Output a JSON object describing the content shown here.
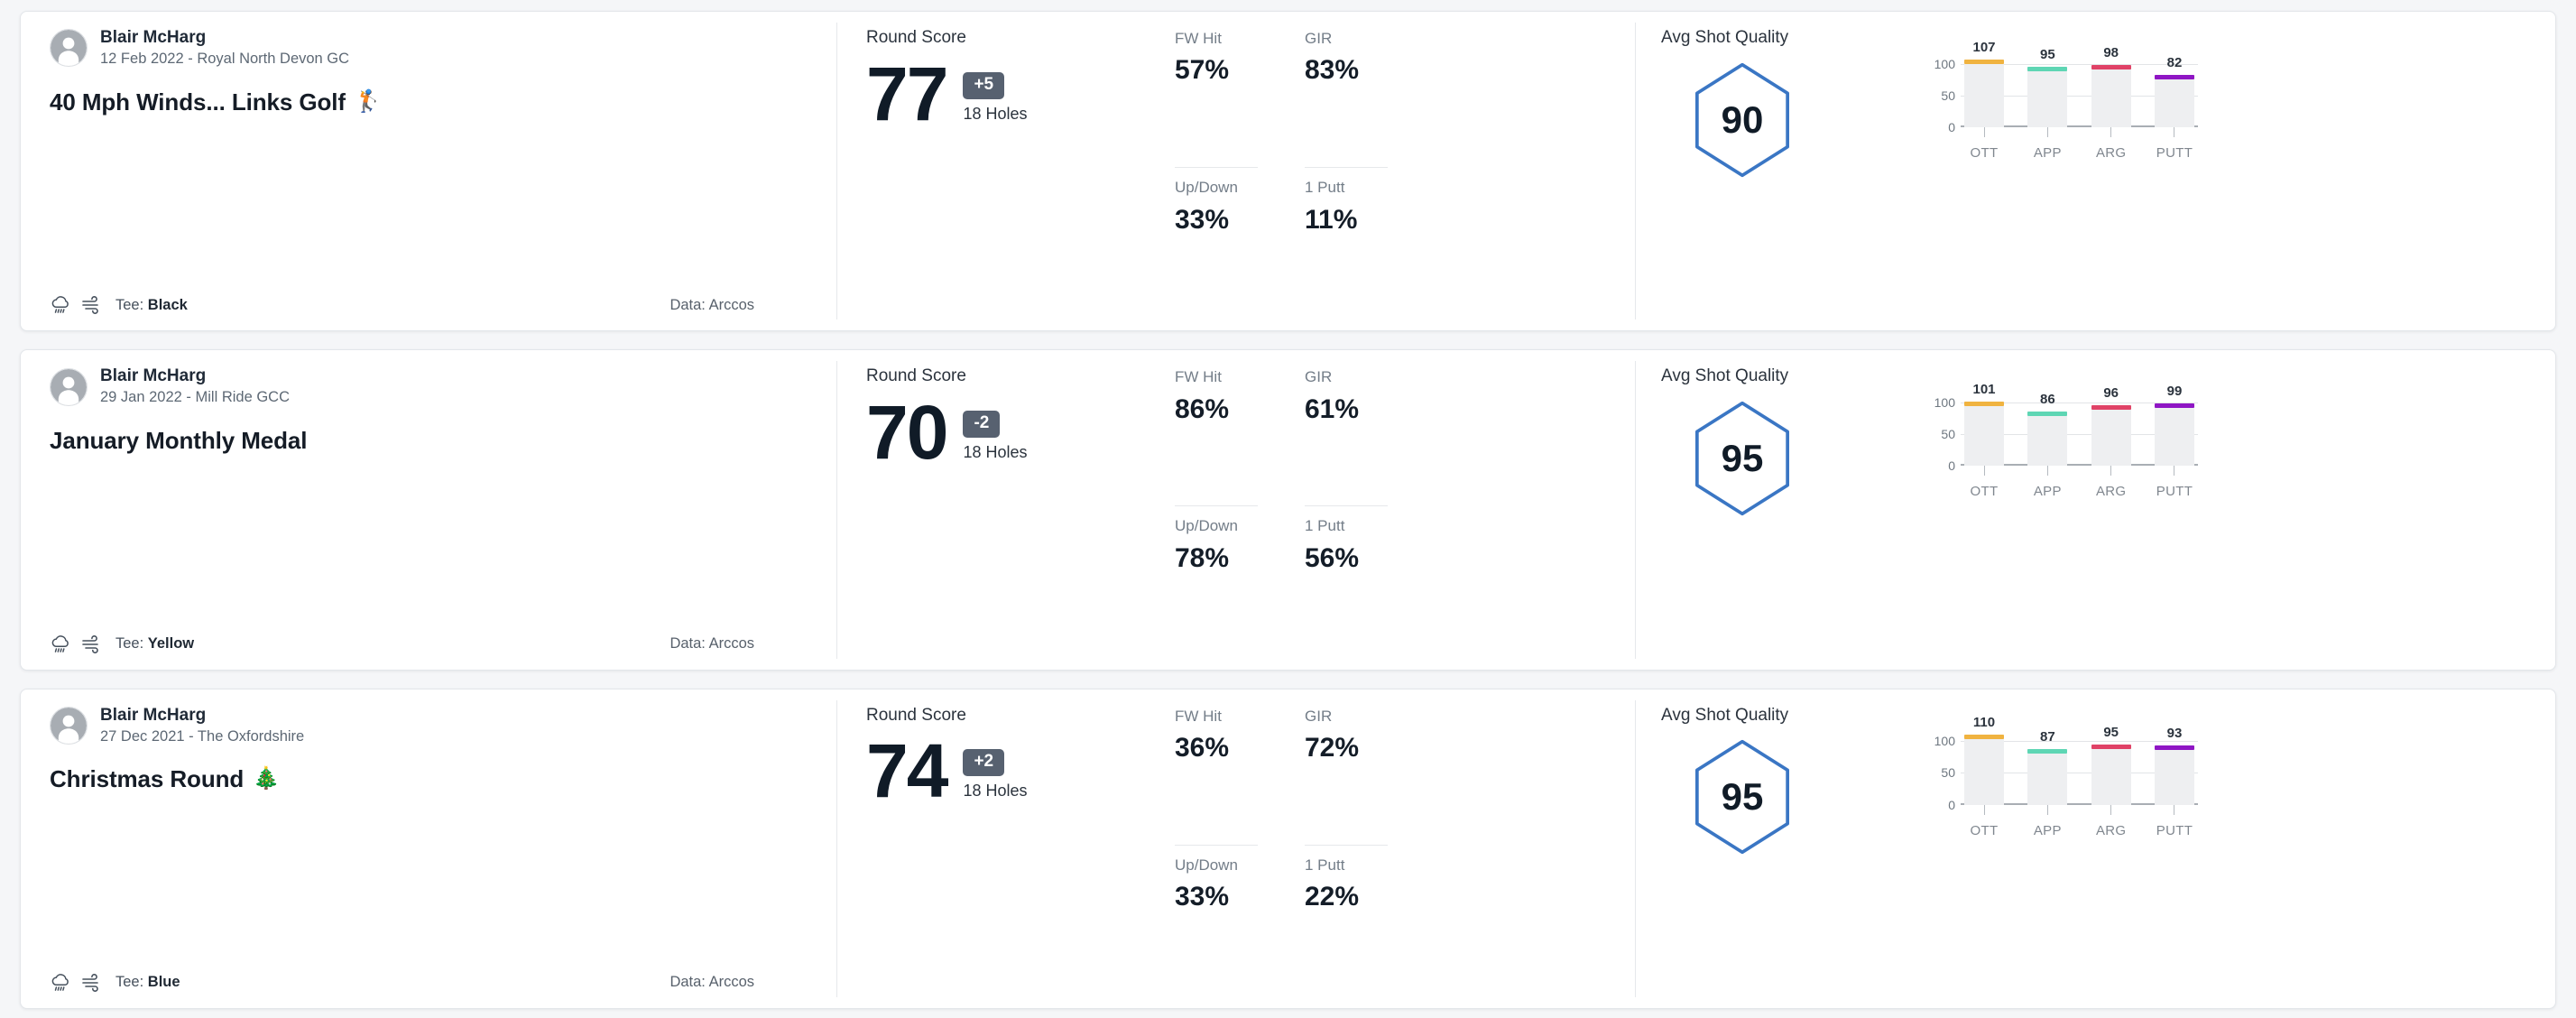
{
  "labels": {
    "round_score": "Round Score",
    "holes": "18 Holes",
    "avg_shot_quality": "Avg Shot Quality",
    "tee_prefix": "Tee:",
    "data_prefix": "Data:",
    "stat_fw": "FW Hit",
    "stat_gir": "GIR",
    "stat_updown": "Up/Down",
    "stat_1putt": "1 Putt"
  },
  "colors": {
    "ott": "#f0b340",
    "app": "#5ed6b4",
    "arg": "#e04267",
    "putt": "#8f16c4",
    "hexagon_stroke": "#3a76c4",
    "score_badge_bg": "#576170",
    "bar_track": "#eeeff1"
  },
  "axis": {
    "y_ticks": [
      "100",
      "50",
      "0"
    ],
    "y_max": 125,
    "categories": [
      "OTT",
      "APP",
      "ARG",
      "PUTT"
    ]
  },
  "rounds": [
    {
      "player": "Blair McHarg",
      "date_course": "12 Feb 2022 - Royal North Devon GC",
      "title": "40 Mph Winds... Links Golf",
      "title_emoji": "🏌️",
      "weather_icon": "rain-cloud-icon",
      "wind_icon": "wind-icon",
      "tee": "Black",
      "data_source": "Arccos",
      "score": "77",
      "diff": "+5",
      "holes": "18 Holes",
      "stats": {
        "fw_hit": "57%",
        "gir": "83%",
        "up_down": "33%",
        "one_putt": "11%"
      },
      "quality": "90",
      "chart_data": {
        "type": "bar",
        "title": "Avg Shot Quality",
        "categories": [
          "OTT",
          "APP",
          "ARG",
          "PUTT"
        ],
        "values": [
          107,
          95,
          98,
          82
        ],
        "ylim": [
          0,
          125
        ],
        "ylabel": "",
        "xlabel": "",
        "grid": true,
        "legend": "none",
        "series_colors": [
          "#f0b340",
          "#5ed6b4",
          "#e04267",
          "#8f16c4"
        ]
      }
    },
    {
      "player": "Blair McHarg",
      "date_course": "29 Jan 2022 - Mill Ride GCC",
      "title": "January Monthly Medal",
      "title_emoji": "",
      "weather_icon": "rain-cloud-icon",
      "wind_icon": "wind-icon",
      "tee": "Yellow",
      "data_source": "Arccos",
      "score": "70",
      "diff": "-2",
      "holes": "18 Holes",
      "stats": {
        "fw_hit": "86%",
        "gir": "61%",
        "up_down": "78%",
        "one_putt": "56%"
      },
      "quality": "95",
      "chart_data": {
        "type": "bar",
        "title": "Avg Shot Quality",
        "categories": [
          "OTT",
          "APP",
          "ARG",
          "PUTT"
        ],
        "values": [
          101,
          86,
          96,
          99
        ],
        "ylim": [
          0,
          125
        ],
        "ylabel": "",
        "xlabel": "",
        "grid": true,
        "legend": "none",
        "series_colors": [
          "#f0b340",
          "#5ed6b4",
          "#e04267",
          "#8f16c4"
        ]
      }
    },
    {
      "player": "Blair McHarg",
      "date_course": "27 Dec 2021 - The Oxfordshire",
      "title": "Christmas Round",
      "title_emoji": "🎄",
      "weather_icon": "rain-cloud-icon",
      "wind_icon": "wind-icon",
      "tee": "Blue",
      "data_source": "Arccos",
      "score": "74",
      "diff": "+2",
      "holes": "18 Holes",
      "stats": {
        "fw_hit": "36%",
        "gir": "72%",
        "up_down": "33%",
        "one_putt": "22%"
      },
      "quality": "95",
      "chart_data": {
        "type": "bar",
        "title": "Avg Shot Quality",
        "categories": [
          "OTT",
          "APP",
          "ARG",
          "PUTT"
        ],
        "values": [
          110,
          87,
          95,
          93
        ],
        "ylim": [
          0,
          125
        ],
        "ylabel": "",
        "xlabel": "",
        "grid": true,
        "legend": "none",
        "series_colors": [
          "#f0b340",
          "#5ed6b4",
          "#e04267",
          "#8f16c4"
        ]
      }
    }
  ]
}
